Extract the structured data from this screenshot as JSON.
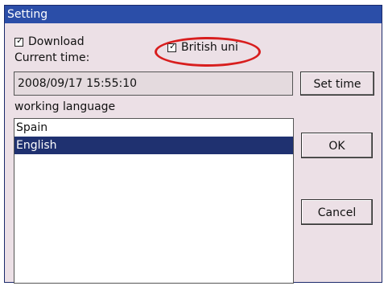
{
  "window": {
    "title": "Setting"
  },
  "download": {
    "label": "Download",
    "checked": true
  },
  "british": {
    "label": "British uni",
    "checked": true
  },
  "current_time": {
    "label": "Current time:",
    "value": "2008/09/17 15:55:10"
  },
  "buttons": {
    "set_time": "Set time",
    "ok": "OK",
    "cancel": "Cancel"
  },
  "language": {
    "label": "working language",
    "options": [
      "Spain",
      "English"
    ],
    "selected": "English"
  },
  "colors": {
    "title_bar": "#2b4ea8",
    "selection": "#1f3170",
    "annotation": "#d81e1e",
    "dialog_bg": "#ece0e6"
  }
}
